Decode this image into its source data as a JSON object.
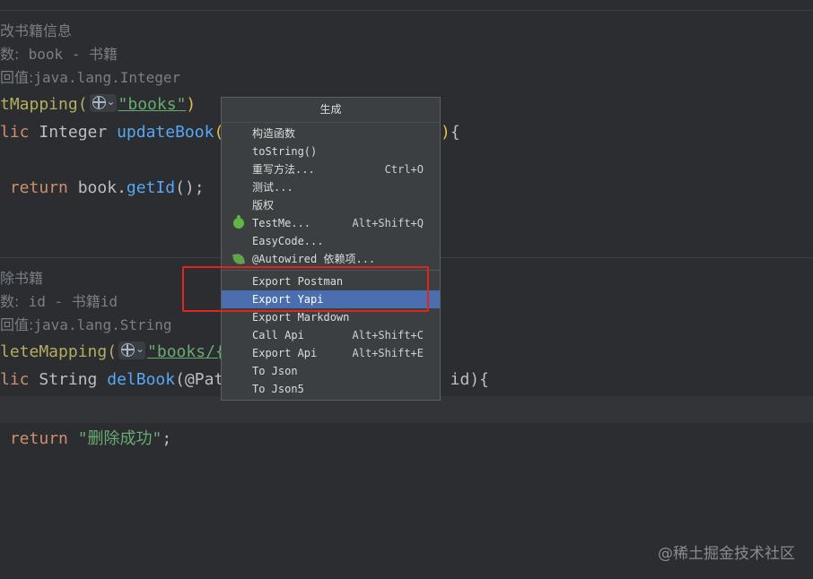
{
  "editor": {
    "block1": {
      "doc_title": "改书籍信息",
      "doc_param_label": "数:",
      "doc_param_value": "book - 书籍",
      "doc_return_label": "回值:",
      "doc_return_value": "java.lang.Integer",
      "annotation": "tMapping(",
      "annotation_string": "\"books\"",
      "annotation_close": ")",
      "signature_kw": "lic",
      "signature_type": "Integer",
      "signature_fn": "updateBook",
      "signature_open": "(",
      "signature_tail": ")",
      "signature_brace": "{",
      "return_kw": "return",
      "return_expr": "book.",
      "return_fn": "getId",
      "return_tail": "();"
    },
    "block2": {
      "doc_title": "除书籍",
      "doc_param_label": "数:",
      "doc_param_value": "id - 书籍id",
      "doc_return_label": "回值:",
      "doc_return_value": "java.lang.String",
      "annotation": "leteMapping(",
      "annotation_string": "\"books/{i",
      "signature_kw": "lic",
      "signature_type": "String",
      "signature_fn": "delBook",
      "signature_open": "(@Pat",
      "signature_tail": "r id){",
      "return_kw": "return",
      "return_string": "\"删除成功\"",
      "return_tail": ";"
    }
  },
  "popup": {
    "title": "生成",
    "items": [
      {
        "label": "构造函数",
        "shortcut": "",
        "icon": ""
      },
      {
        "label": "toString()",
        "shortcut": "",
        "icon": ""
      },
      {
        "label": "重写方法...",
        "shortcut": "Ctrl+O",
        "icon": ""
      },
      {
        "label": "测试...",
        "shortcut": "",
        "icon": ""
      },
      {
        "label": "版权",
        "shortcut": "",
        "icon": ""
      },
      {
        "label": "TestMe...",
        "shortcut": "Alt+Shift+Q",
        "icon": "testme-bug-icon"
      },
      {
        "label": "EasyCode...",
        "shortcut": "",
        "icon": ""
      },
      {
        "label": "@Autowired 依赖项...",
        "shortcut": "",
        "icon": "spring-leaf-icon"
      },
      {
        "label": "Export Postman",
        "shortcut": "",
        "icon": ""
      },
      {
        "label": "Export Yapi",
        "shortcut": "",
        "icon": "",
        "selected": true
      },
      {
        "label": "Export Markdown",
        "shortcut": "",
        "icon": ""
      },
      {
        "label": "Call Api",
        "shortcut": "Alt+Shift+C",
        "icon": ""
      },
      {
        "label": "Export Api",
        "shortcut": "Alt+Shift+E",
        "icon": ""
      },
      {
        "label": "To Json",
        "shortcut": "",
        "icon": ""
      },
      {
        "label": "To Json5",
        "shortcut": "",
        "icon": ""
      }
    ]
  },
  "watermark": "@稀土掘金技术社区",
  "colors": {
    "background": "#2b2d30",
    "selection": "#4b6eaf",
    "highlight_box": "#e1251b"
  }
}
